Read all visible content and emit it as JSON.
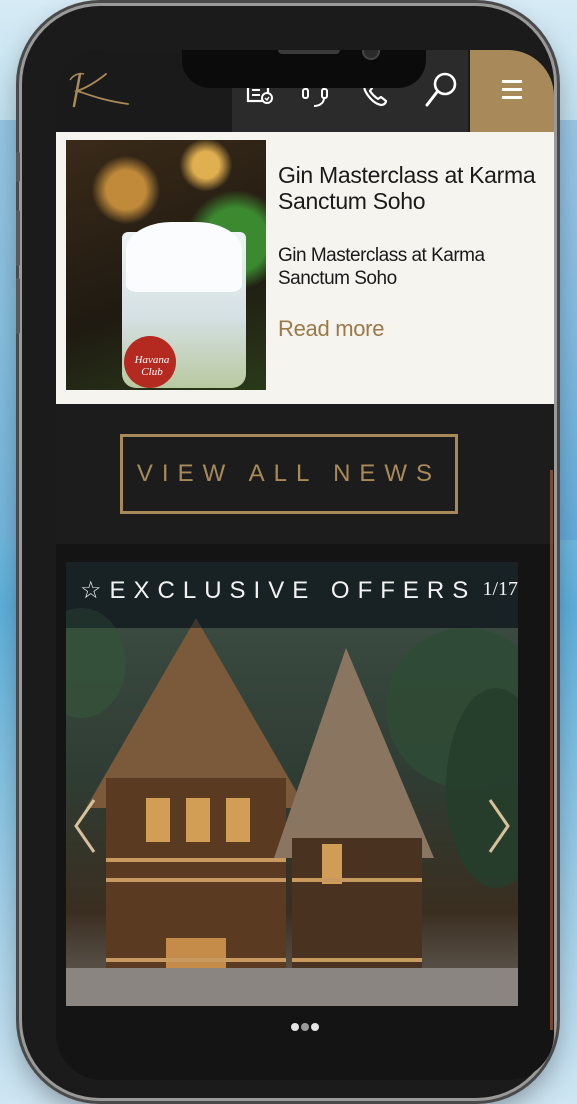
{
  "header": {
    "logo_letter": "K",
    "icons": [
      "brochure-icon",
      "concierge-icon",
      "phone-icon",
      "search-icon",
      "menu-icon"
    ],
    "accent": "#a88a5a"
  },
  "news": {
    "title": "Gin Masterclass at Karma Sanctum Soho",
    "description": "Gin Masterclass at Karma Sanctum Soho",
    "read_more": "Read more",
    "image_label": "Havana Club"
  },
  "view_all_label": "VIEW ALL NEWS",
  "offers": {
    "title": "EXCLUSIVE OFFERS",
    "star": "☆",
    "counter": "1/17",
    "dots": [
      false,
      true,
      false
    ]
  }
}
